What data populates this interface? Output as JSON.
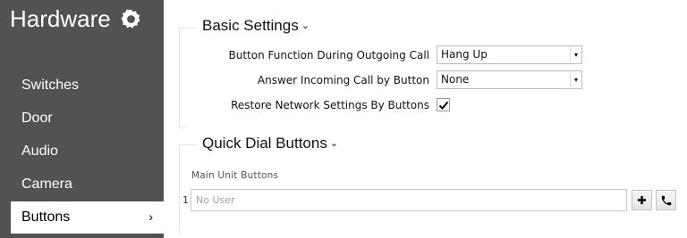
{
  "sidebar": {
    "title": "Hardware",
    "title_icon": "gear-icon",
    "items": [
      {
        "label": "Switches",
        "active": false
      },
      {
        "label": "Door",
        "active": false
      },
      {
        "label": "Audio",
        "active": false
      },
      {
        "label": "Camera",
        "active": false
      },
      {
        "label": "Buttons",
        "active": true,
        "chevron": "›"
      }
    ]
  },
  "basic_settings": {
    "title": "Basic Settings",
    "caret": "⌄",
    "fields": [
      {
        "label": "Button Function During Outgoing Call",
        "value": "Hang Up"
      },
      {
        "label": "Answer Incoming Call by Button",
        "value": "None"
      }
    ],
    "restore": {
      "label": "Restore Network Settings By Buttons",
      "checked": true
    }
  },
  "quick_dial": {
    "title": "Quick Dial Buttons",
    "caret": "⌄",
    "subheading": "Main Unit Buttons",
    "rows": [
      {
        "number": "1",
        "placeholder": "No User"
      }
    ],
    "add_icon": "plus-icon",
    "call_icon": "phone-icon"
  }
}
